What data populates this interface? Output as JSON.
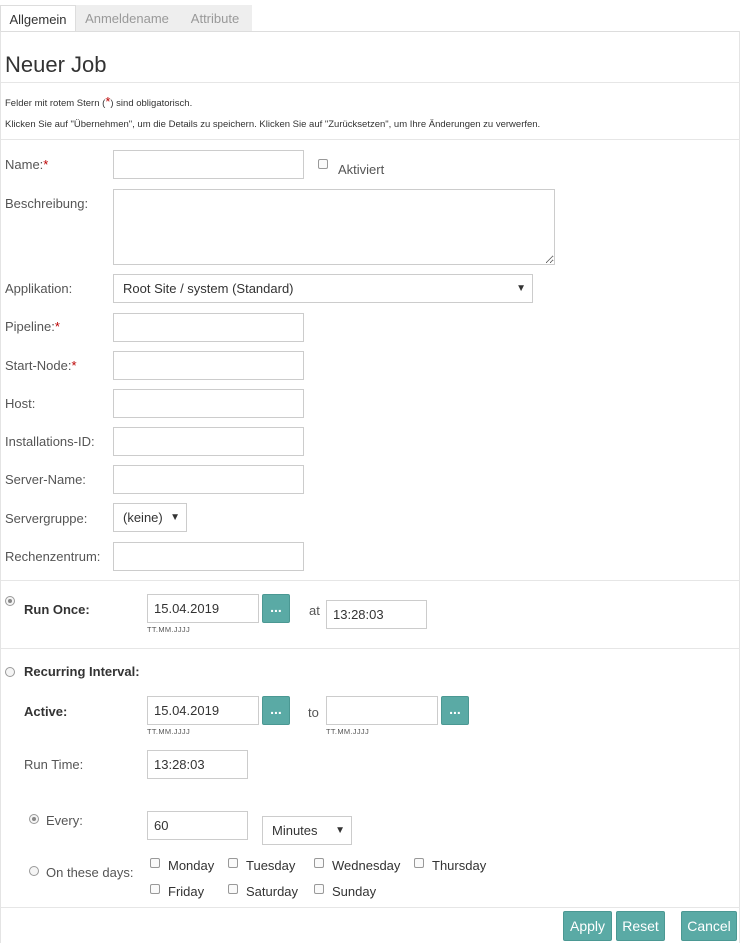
{
  "tabs": [
    {
      "label": "Allgemein"
    },
    {
      "label": "Anmeldename"
    },
    {
      "label": "Attribute"
    }
  ],
  "page_title": "Neuer Job",
  "notes": {
    "required_prefix": "Felder mit rotem Stern (",
    "required_star": "*",
    "required_suffix": ") sind obligatorisch.",
    "instructions": "Klicken Sie auf \"Übernehmen\", um die Details zu speichern. Klicken Sie auf \"Zurücksetzen\", um Ihre Änderungen zu verwerfen."
  },
  "form": {
    "name_label": "Name:",
    "name_value": "",
    "activated_label": "Aktiviert",
    "activated_checked": false,
    "description_label": "Beschreibung:",
    "description_value": "",
    "application_label": "Applikation:",
    "application_value": "Root Site / system (Standard)",
    "pipeline_label": "Pipeline:",
    "pipeline_value": "",
    "start_node_label": "Start-Node:",
    "start_node_value": "",
    "host_label": "Host:",
    "host_value": "",
    "installation_id_label": "Installations-ID:",
    "installation_id_value": "",
    "server_name_label": "Server-Name:",
    "server_name_value": "",
    "server_group_label": "Servergruppe:",
    "server_group_value": "(keine)",
    "data_center_label": "Rechenzentrum:",
    "data_center_value": "",
    "required_star": "*"
  },
  "schedule": {
    "run_once": {
      "label": "Run Once:",
      "selected": true,
      "date": "15.04.2019",
      "date_hint": "TT.MM.JJJJ",
      "picker_label": "...",
      "at_label": "at",
      "time": "13:28:03"
    },
    "recurring": {
      "label": "Recurring Interval:",
      "selected": false,
      "active_label": "Active:",
      "from_date": "15.04.2019",
      "from_hint": "TT.MM.JJJJ",
      "to_label": "to",
      "to_date": "",
      "to_hint": "TT.MM.JJJJ",
      "picker_label": "...",
      "run_time_label": "Run Time:",
      "run_time": "13:28:03",
      "every_label": "Every:",
      "every_selected": true,
      "every_value": "60",
      "every_unit": "Minutes",
      "days_label": "On these days:",
      "days_selected": false,
      "days": [
        "Monday",
        "Tuesday",
        "Wednesday",
        "Thursday",
        "Friday",
        "Saturday",
        "Sunday"
      ]
    }
  },
  "buttons": {
    "apply": "Apply",
    "reset": "Reset",
    "cancel": "Cancel"
  },
  "colors": {
    "accent": "#5aaaa5",
    "required": "#bb0000"
  }
}
